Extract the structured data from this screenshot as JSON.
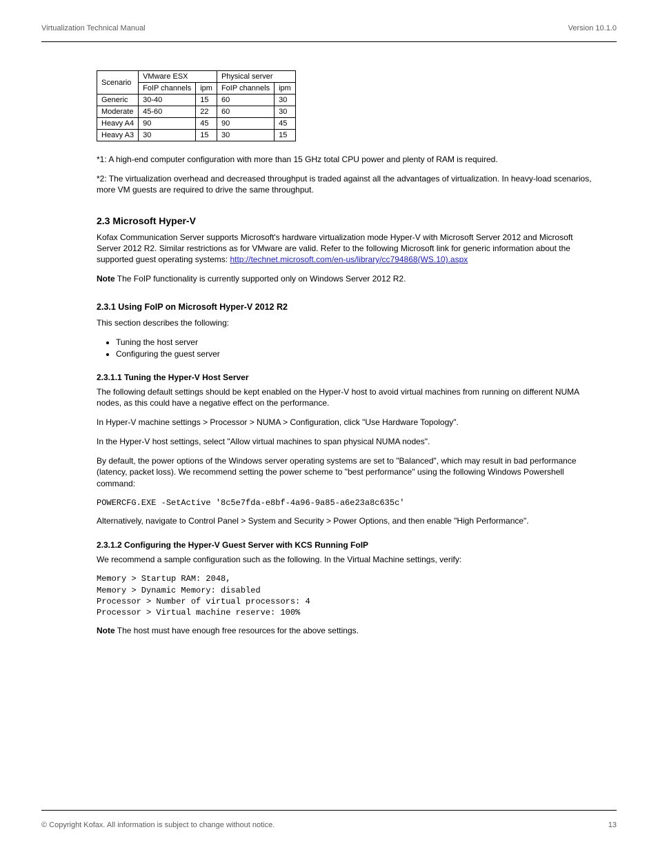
{
  "header": {
    "left": "Virtualization Technical Manual",
    "right": "Version 10.1.0"
  },
  "footer": {
    "left": "© Copyright Kofax. All information is subject to change without notice.",
    "right": "13"
  },
  "table": {
    "rows": [
      [
        "Scenario",
        "VMware ESX",
        "",
        "Physical server",
        ""
      ],
      [
        "",
        "FoIP channels",
        "ipm",
        "FoIP channels",
        "ipm"
      ],
      [
        "Generic",
        "30-40",
        "15",
        "60",
        "30"
      ],
      [
        "Moderate",
        "45-60",
        "22",
        "60",
        "30"
      ],
      [
        "Heavy A4",
        "90",
        "45",
        "90",
        "45"
      ],
      [
        "Heavy A3",
        "30",
        "15",
        "30",
        "15"
      ]
    ]
  },
  "notes": {
    "n1": "*1: A high-end computer configuration with more than 15 GHz total CPU power and plenty of RAM is required.",
    "n2": "*2: The virtualization overhead and decreased throughput is traded against all the advantages of virtualization. In heavy-load scenarios, more VM guests are required to drive the same throughput."
  },
  "hyperv": {
    "heading": "2.3 Microsoft Hyper-V",
    "p1a": "Kofax Communication Server supports Microsoft's hardware virtualization mode Hyper-V with Microsoft Server 2012 and Microsoft Server 2012 R2. Similar restrictions as for VMware are valid. Refer to the following Microsoft link for generic information about the supported guest operating systems: ",
    "link": "http://technet.microsoft.com/en-us/library/cc794868(WS.10).aspx",
    "p1b": "",
    "note_label": "Note",
    "note_text": " The FoIP functionality is currently supported only on Windows Server 2012 R2.",
    "h4": "2.3.1 Using FoIP on Microsoft Hyper-V 2012 R2",
    "intro": "This section describes the following:",
    "bullets": [
      "Tuning the host server",
      "Configuring the guest server"
    ],
    "h5a": "2.3.1.1 Tuning the Hyper-V Host Server",
    "tune1": "The following default settings should be kept enabled on the Hyper-V host to avoid virtual machines from running on different NUMA nodes, as this could have a negative effect on the performance.",
    "cmd1": "In Hyper-V machine settings > Processor > NUMA > Configuration, click \"Use Hardware Topology\".",
    "cmd2": "In the Hyper-V host settings, select \"Allow virtual machines to span physical NUMA nodes\".",
    "tune2": "By default, the power options of the Windows server operating systems are set to \"Balanced\", which may result in bad performance (latency, packet loss). We recommend setting the power scheme to \"best performance\" using the following Windows Powershell command:",
    "code1": "POWERCFG.EXE -SetActive '8c5e7fda-e8bf-4a96-9a85-a6e23a8c635c'",
    "tune3": "Alternatively, navigate to Control Panel > System and Security > Power Options, and then enable \"High Performance\".",
    "h5b": "2.3.1.2 Configuring the Hyper-V Guest Server with KCS Running FoIP",
    "guest1": "We recommend a sample configuration such as the following. In the Virtual Machine settings, verify:",
    "code2": "Memory > Startup RAM: 2048,\nMemory > Dynamic Memory: disabled\nProcessor > Number of virtual processors: 4\nProcessor > Virtual machine reserve: 100%",
    "note2_label": "Note",
    "note2_text": " The host must have enough free resources for the above settings."
  }
}
